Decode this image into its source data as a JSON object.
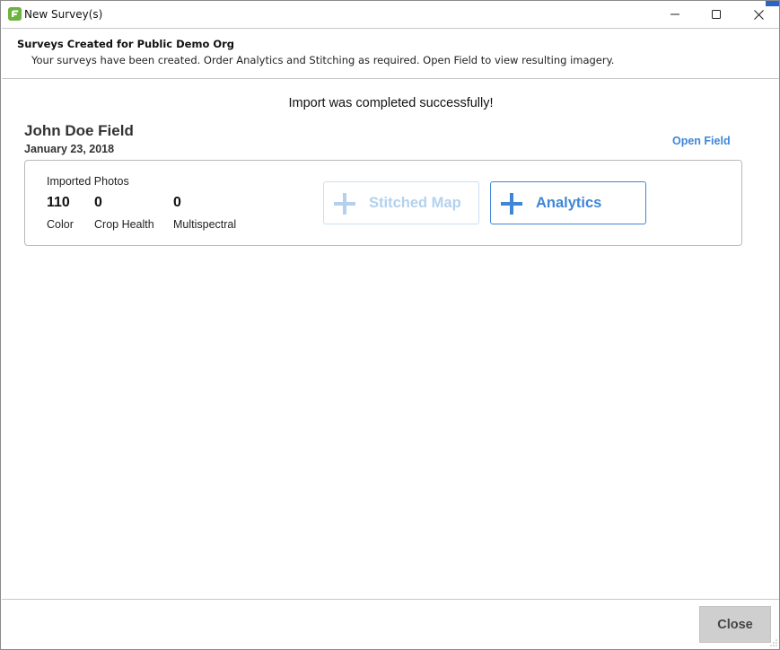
{
  "window": {
    "title": "New Survey(s)",
    "controls": {
      "minimize": "minimize-icon",
      "maximize": "maximize-icon",
      "close": "close-icon"
    }
  },
  "header": {
    "title": "Surveys Created for Public Demo Org",
    "subtitle": "Your surveys have been created. Order Analytics and Stitching as required. Open Field to view resulting imagery."
  },
  "main": {
    "status_message": "Import was completed successfully!",
    "field": {
      "name": "John Doe Field",
      "date": "January 23, 2018",
      "open_link": "Open Field"
    },
    "card": {
      "imported_label": "Imported Photos",
      "stats": [
        {
          "value": "110",
          "label": "Color"
        },
        {
          "value": "0",
          "label": "Crop Health"
        },
        {
          "value": "0",
          "label": "Multispectral"
        }
      ],
      "buttons": {
        "stitched_map": {
          "label": "Stitched Map",
          "icon": "plus-icon",
          "enabled": false
        },
        "analytics": {
          "label": "Analytics",
          "icon": "plus-icon",
          "enabled": true
        }
      }
    }
  },
  "footer": {
    "close_label": "Close"
  },
  "colors": {
    "accent": "#3f86d6",
    "accent_disabled": "#b3d1ee",
    "brand_green": "#6db33f",
    "close_button_bg": "#cfcfcf"
  }
}
